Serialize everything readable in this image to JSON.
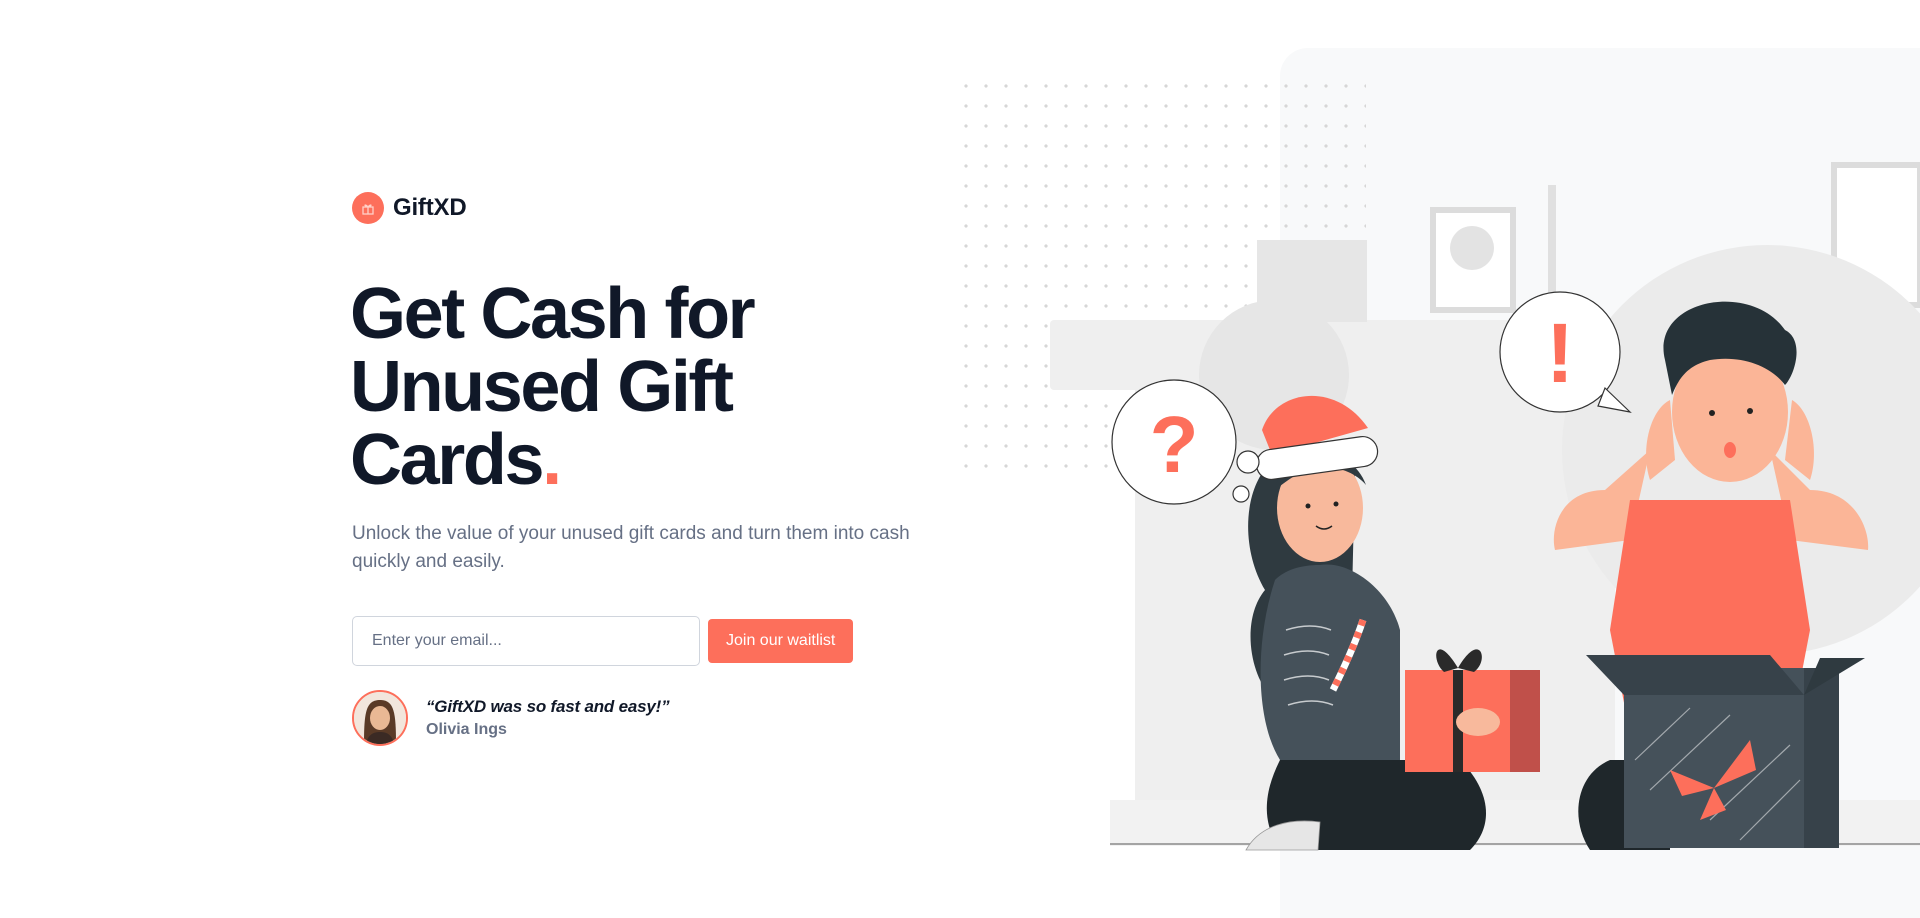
{
  "brand": {
    "name": "GiftXD",
    "icon": "gift-icon",
    "accent": "#fd6f5b"
  },
  "hero": {
    "headline": "Get Cash for Unused Gift Cards",
    "headline_dot": ".",
    "subtext": "Unlock the value of your unused gift cards and turn them into cash quickly and easily."
  },
  "signup": {
    "email_placeholder": "Enter your email...",
    "button_label": "Join our waitlist"
  },
  "testimonial": {
    "quote": "“GiftXD was so fast and easy!”",
    "author": "Olivia Ings"
  },
  "illustration": {
    "question_mark": "?",
    "exclamation_mark": "!"
  },
  "colors": {
    "text": "#101828",
    "muted": "#667085",
    "panel": "#f8f9fa"
  }
}
